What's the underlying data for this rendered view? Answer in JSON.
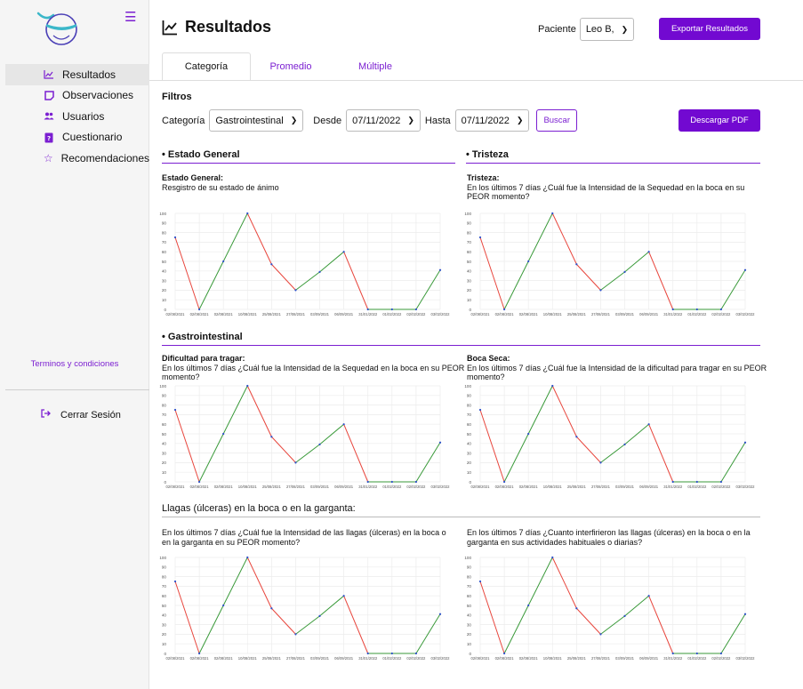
{
  "sidebar": {
    "items": [
      {
        "label": "Resultados",
        "icon": "chart-line-icon",
        "active": true
      },
      {
        "label": "Observaciones",
        "icon": "note-icon",
        "active": false
      },
      {
        "label": "Usuarios",
        "icon": "users-icon",
        "active": false
      },
      {
        "label": "Cuestionario",
        "icon": "clipboard-question-icon",
        "active": false
      },
      {
        "label": "Recomendaciones",
        "icon": "star-icon",
        "active": false
      }
    ],
    "terms": "Terminos y condiciones",
    "logout": "Cerrar Sesión"
  },
  "header": {
    "title": "Resultados",
    "patient_label": "Paciente",
    "patient_value": "Leo B,",
    "export_button": "Exportar Resultados"
  },
  "tabs": [
    {
      "label": "Categoría",
      "active": true
    },
    {
      "label": "Promedio",
      "active": false
    },
    {
      "label": "Múltiple",
      "active": false
    }
  ],
  "filters": {
    "title": "Filtros",
    "category_label": "Categoría",
    "category_value": "Gastrointestinal",
    "from_label": "Desde",
    "from_value": "07/11/2022",
    "to_label": "Hasta",
    "to_value": "07/11/2022",
    "search_button": "Buscar",
    "pdf_button": "Descargar PDF"
  },
  "sections": {
    "estado_general": "• Estado General",
    "tristeza": "• Tristeza",
    "gastrointestinal": "• Gastrointestinal",
    "llagas": "Llagas (úlceras) en la boca o en la garganta:"
  },
  "colors": {
    "accent": "#7209d1",
    "decline": "#e8453c",
    "rise": "#3a9a3a",
    "point": "#2c4fc9"
  },
  "chart_titles": {
    "c1_bold": "Estado General:",
    "c1_sub": "Resgistro de su estado de ánimo",
    "c2_bold": "Tristeza:",
    "c2_sub": "En los últimos 7 días ¿Cuál fue la Intensidad de la Sequedad en la boca en su PEOR momento?",
    "c3_bold": "Dificultad para tragar:",
    "c3_sub": "En los últimos 7 días ¿Cuál fue la Intensidad de la Sequedad en la boca en su PEOR momento?",
    "c4_bold": "Boca Seca:",
    "c4_sub": "En los últimos 7 días ¿Cuál fue la Intensidad de la dificultad para tragar en su PEOR momento?",
    "c5_sub": "En los últimos 7 días ¿Cuál fue la Intensidad de las llagas (úlceras) en la boca o en la garganta en su PEOR momento?",
    "c6_sub": "En los últimos 7 días ¿Cuanto interfirieron las llagas (úlceras) en la boca o en la garganta en sus actividades habituales o diarias?"
  },
  "chart_data": [
    {
      "type": "line",
      "categories": [
        "02/08/2021",
        "02/08/2021",
        "02/08/2021",
        "10/08/2021",
        "25/08/2021",
        "27/08/2021",
        "03/09/2021",
        "06/09/2021",
        "31/01/2022",
        "01/02/2022",
        "02/02/2022",
        "03/02/2022"
      ],
      "values": [
        75,
        0,
        50,
        100,
        47,
        20,
        39,
        60,
        0,
        0,
        0,
        41
      ],
      "yticks": [
        0,
        10,
        20,
        30,
        40,
        50,
        60,
        70,
        80,
        90,
        100
      ],
      "ylim": [
        0,
        100
      ],
      "grid": true
    },
    {
      "type": "line",
      "categories": [
        "02/08/2021",
        "02/08/2021",
        "02/08/2021",
        "10/08/2021",
        "25/08/2021",
        "27/08/2021",
        "03/09/2021",
        "06/09/2021",
        "31/01/2022",
        "01/02/2022",
        "02/02/2022",
        "03/02/2022"
      ],
      "values": [
        75,
        0,
        50,
        100,
        47,
        20,
        39,
        60,
        0,
        0,
        0,
        41
      ],
      "yticks": [
        0,
        10,
        20,
        30,
        40,
        50,
        60,
        70,
        80,
        90,
        100
      ],
      "ylim": [
        0,
        100
      ],
      "grid": true
    },
    {
      "type": "line",
      "categories": [
        "02/08/2021",
        "02/08/2021",
        "02/08/2021",
        "10/08/2021",
        "25/08/2021",
        "27/08/2021",
        "03/09/2021",
        "06/09/2021",
        "31/01/2022",
        "01/02/2022",
        "02/02/2022",
        "03/02/2022"
      ],
      "values": [
        75,
        0,
        50,
        100,
        47,
        20,
        39,
        60,
        0,
        0,
        0,
        41
      ],
      "yticks": [
        0,
        10,
        20,
        30,
        40,
        50,
        60,
        70,
        80,
        90,
        100
      ],
      "ylim": [
        0,
        100
      ],
      "grid": true
    },
    {
      "type": "line",
      "categories": [
        "02/08/2021",
        "02/08/2021",
        "02/08/2021",
        "10/08/2021",
        "25/08/2021",
        "27/08/2021",
        "03/09/2021",
        "06/09/2021",
        "31/01/2022",
        "01/02/2022",
        "02/02/2022",
        "03/02/2022"
      ],
      "values": [
        75,
        0,
        50,
        100,
        47,
        20,
        39,
        60,
        0,
        0,
        0,
        41
      ],
      "yticks": [
        0,
        10,
        20,
        30,
        40,
        50,
        60,
        70,
        80,
        90,
        100
      ],
      "ylim": [
        0,
        100
      ],
      "grid": true
    },
    {
      "type": "line",
      "categories": [
        "02/08/2021",
        "02/08/2021",
        "02/08/2021",
        "10/08/2021",
        "25/08/2021",
        "27/08/2021",
        "03/09/2021",
        "06/09/2021",
        "31/01/2022",
        "01/02/2022",
        "02/02/2022",
        "03/02/2022"
      ],
      "values": [
        75,
        0,
        50,
        100,
        47,
        20,
        39,
        60,
        0,
        0,
        0,
        41
      ],
      "yticks": [
        0,
        10,
        20,
        30,
        40,
        50,
        60,
        70,
        80,
        90,
        100
      ],
      "ylim": [
        0,
        100
      ],
      "grid": true
    },
    {
      "type": "line",
      "categories": [
        "02/08/2021",
        "02/08/2021",
        "02/08/2021",
        "10/08/2021",
        "25/08/2021",
        "27/08/2021",
        "03/09/2021",
        "06/09/2021",
        "31/01/2022",
        "01/02/2022",
        "02/02/2022",
        "03/02/2022"
      ],
      "values": [
        75,
        0,
        50,
        100,
        47,
        20,
        39,
        60,
        0,
        0,
        0,
        41
      ],
      "yticks": [
        0,
        10,
        20,
        30,
        40,
        50,
        60,
        70,
        80,
        90,
        100
      ],
      "ylim": [
        0,
        100
      ],
      "grid": true
    }
  ]
}
